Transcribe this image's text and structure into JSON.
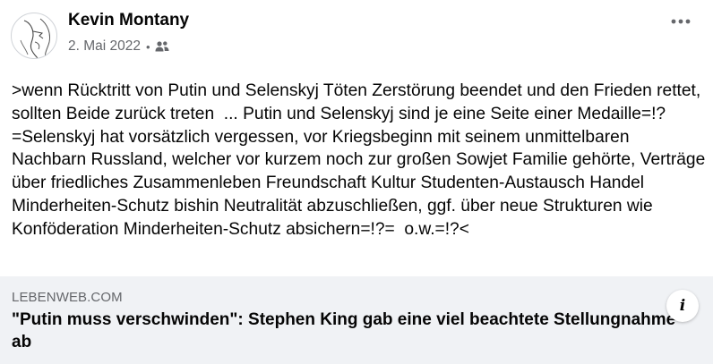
{
  "post": {
    "author": "Kevin Montany",
    "date": "2. Mai 2022",
    "separator": "•",
    "audience_icon": "friends-icon",
    "more_icon": "more-horizontal-icon",
    "text": ">wenn Rücktritt von Putin und Selenskyj Töten Zerstörung beendet und den Frieden rettet, sollten Beide zurück treten  ... Putin und Selenskyj sind je eine Seite einer Medaille=!?=Selenskyj hat vorsätzlich vergessen, vor Kriegsbeginn mit seinem unmittelbaren Nachbarn Russland, welcher vor kurzem noch zur großen Sowjet Familie gehörte, Verträge über friedliches Zusammenleben Freundschaft Kultur Studenten-Austausch Handel Minderheiten-Schutz bishin Neutralität abzuschließen, ggf. über neue Strukturen wie Konföderation Minderheiten-Schutz absichern=!?=  o.w.=!?<"
  },
  "link": {
    "domain": "LEBENWEB.COM",
    "title": "\"Putin muss verschwinden\": Stephen King gab eine viel beachtete Stellungnahme ab",
    "info_label": "i"
  },
  "colors": {
    "text": "#050505",
    "secondary": "#65676b",
    "preview_bg": "#f0f2f5"
  }
}
